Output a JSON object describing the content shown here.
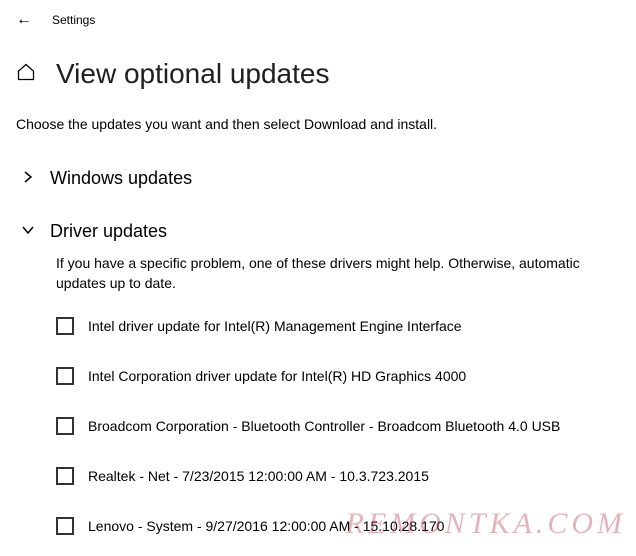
{
  "header": {
    "settings_label": "Settings"
  },
  "title": "View optional updates",
  "instruction": "Choose the updates you want and then select Download and install.",
  "sections": {
    "windows": {
      "label": "Windows updates",
      "expanded": false
    },
    "driver": {
      "label": "Driver updates",
      "expanded": true,
      "description": "If you have a specific problem, one of these drivers might help. Otherwise, automatic updates up to date.",
      "items": [
        {
          "label": "Intel driver update for Intel(R) Management Engine Interface",
          "checked": false
        },
        {
          "label": "Intel Corporation driver update for Intel(R) HD Graphics 4000",
          "checked": false
        },
        {
          "label": "Broadcom Corporation - Bluetooth Controller - Broadcom Bluetooth 4.0 USB",
          "checked": false
        },
        {
          "label": "Realtek - Net - 7/23/2015 12:00:00 AM - 10.3.723.2015",
          "checked": false
        },
        {
          "label": "Lenovo - System - 9/27/2016 12:00:00 AM - 15.10.28.170",
          "checked": false
        }
      ]
    }
  },
  "watermark": "REMONTKA.COM"
}
